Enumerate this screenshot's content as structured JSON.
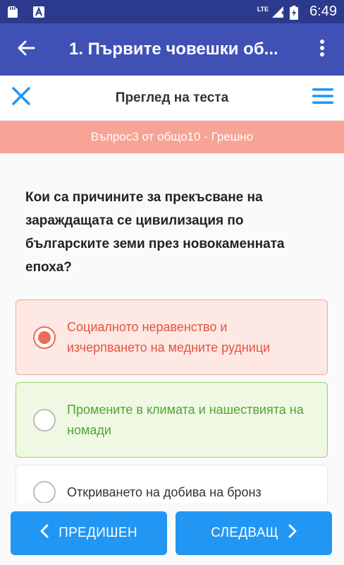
{
  "statusbar": {
    "time": "6:49",
    "network": "LTE",
    "icons": [
      "sd-card-icon",
      "notification-a-icon",
      "signal-icon",
      "battery-charging-icon"
    ]
  },
  "appbar": {
    "title": "1. Първите човешки об...",
    "background": "#3f51b5"
  },
  "subbar": {
    "title": "Преглед на теста"
  },
  "banner": {
    "text": "Въпрос3 от общо10 - Грешно",
    "background": "#f7a395"
  },
  "question": {
    "text": "Кои са причините за прекъсване на зараждащата се цивилизация по българските земи през новокаменната епоха?"
  },
  "answers": [
    {
      "text": "Социалното неравенство и изчерпването на медните рудници",
      "state": "selected-wrong"
    },
    {
      "text": "Промените в климата и нашествията на номади",
      "state": "correct"
    },
    {
      "text": "Откриването на добива на бронз",
      "state": "neutral"
    }
  ],
  "nav": {
    "prev_label": "ПРЕДИШЕН",
    "next_label": "СЛЕДВАЩ",
    "button_color": "#2196f3"
  }
}
